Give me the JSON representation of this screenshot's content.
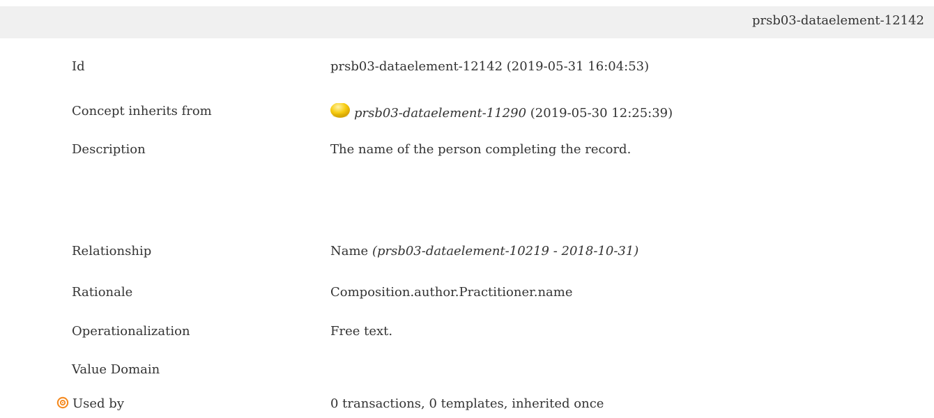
{
  "header": {
    "id_label": "prsb03-dataelement-12142"
  },
  "rows": [
    {
      "label": "Id",
      "value": "prsb03-dataelement-12142 (2019-05-31 16:04:53)"
    },
    {
      "label": "Concept inherits from",
      "value_link": "prsb03-dataelement-11290",
      "value_suffix": " (2019-05-30 12:25:39)",
      "icon": "yellow-circle-icon",
      "icon_color": "#f7c400"
    },
    {
      "label": "Description",
      "value": "The name of the person completing the record."
    },
    {
      "label": "Relationship",
      "value": "Name ",
      "value_italic": "(prsb03-dataelement-10219 - 2018-10-31)"
    },
    {
      "label": "Rationale",
      "value": "Composition.author.Practitioner.name"
    },
    {
      "label": "Operationalization",
      "value": "Free text."
    },
    {
      "label": "Value Domain",
      "value": ""
    },
    {
      "label": "Used by",
      "value": "0 transactions, 0 templates, inherited once",
      "icon": "target-icon",
      "icon_color": "#f58a1f"
    }
  ]
}
